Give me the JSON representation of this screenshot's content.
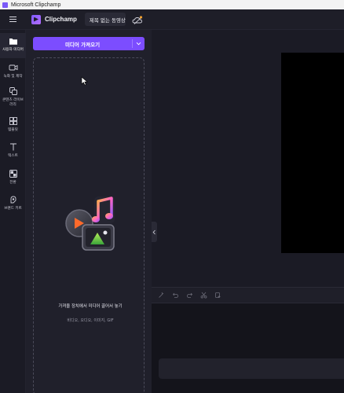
{
  "window": {
    "title": "Microsoft Clipchamp"
  },
  "header": {
    "brand": "Clipchamp",
    "project_title": "제목 없는 동영상"
  },
  "sidebar": {
    "items": [
      {
        "label": "사용자 미디어",
        "icon": "folder-icon",
        "active": true
      },
      {
        "label": "녹화 및 제작",
        "icon": "camera-icon",
        "active": false
      },
      {
        "label": "콘텐츠 라이브러리",
        "icon": "library-icon",
        "active": false
      },
      {
        "label": "템플릿",
        "icon": "templates-icon",
        "active": false
      },
      {
        "label": "텍스트",
        "icon": "text-icon",
        "active": false
      },
      {
        "label": "전환",
        "icon": "transitions-icon",
        "active": false
      },
      {
        "label": "브랜드 키트",
        "icon": "brand-kit-icon",
        "active": false
      }
    ]
  },
  "media_panel": {
    "import_label": "미디어 가져오기",
    "drop_title": "가져올 장치에서 미디어 끌어서 놓기",
    "drop_subtitle": "비디오, 오디오, 이미지, GIF"
  },
  "colors": {
    "accent": "#7c4dff",
    "background": "#1b1b25",
    "panel": "#20202b"
  }
}
